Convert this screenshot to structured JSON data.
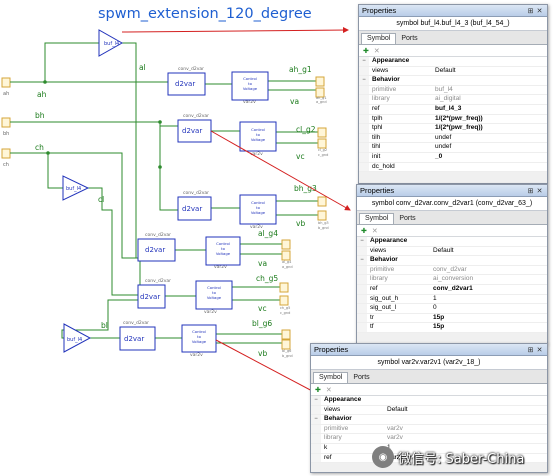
{
  "schematic": {
    "title": "spwm_extension_120_degree",
    "colors": {
      "title": "#1f5fd1",
      "wire": "#2e8b2e",
      "block": "#2233bb",
      "pin": "#d4a63a",
      "arrow": "#d42020",
      "label": "#1a7a1a",
      "caption": "#666666"
    },
    "input_ports": [
      {
        "name": "ah"
      },
      {
        "name": "bh"
      },
      {
        "name": "ch"
      }
    ],
    "net_labels": {
      "ah": "ah",
      "bh": "bh",
      "ch": "ch",
      "al": "al",
      "bl": "bl",
      "cl": "cl"
    },
    "buffers": [
      {
        "name": "buf_l4"
      },
      {
        "name": "buf_l4"
      },
      {
        "name": "buf_l4"
      }
    ],
    "converters": [
      {
        "caption": "conv_d2var",
        "label": "d2var"
      },
      {
        "caption": "conv_d2var",
        "label": "d2var"
      },
      {
        "caption": "conv_d2var",
        "label": "d2var"
      },
      {
        "caption": "conv_d2var",
        "label": "d2var"
      },
      {
        "caption": "conv_d2var",
        "label": "d2var"
      },
      {
        "caption": "conv_d2var",
        "label": "d2var"
      }
    ],
    "ctv_blocks": [
      {
        "caption": "var2v",
        "lines": [
          "Control",
          "to",
          "Voltage"
        ],
        "label": "ah_g1",
        "out": "va",
        "pins": [
          "ah_g1",
          "a_gnd"
        ]
      },
      {
        "caption": "var2v",
        "lines": [
          "Control",
          "to",
          "Voltage"
        ],
        "label": "cl_g2",
        "out": "vc",
        "pins": [
          "cl_g2",
          "c_gnd"
        ]
      },
      {
        "caption": "var2v",
        "lines": [
          "Control",
          "to",
          "Voltage"
        ],
        "label": "bh_g3",
        "out": "vb",
        "pins": [
          "bh_g3",
          "b_gnd"
        ]
      },
      {
        "caption": "var2v",
        "lines": [
          "Control",
          "to",
          "Voltage"
        ],
        "label": "al_g4",
        "out": "va",
        "pins": [
          "al_g4",
          "a_gnd"
        ]
      },
      {
        "caption": "var2v",
        "lines": [
          "Control",
          "to",
          "Voltage"
        ],
        "label": "ch_g5",
        "out": "vc",
        "pins": [
          "ch_g5",
          "c_gnd"
        ]
      },
      {
        "caption": "var2v",
        "lines": [
          "Control",
          "to",
          "Voltage"
        ],
        "label": "bl_g6",
        "out": "vb",
        "pins": [
          "bl_g6",
          "b_gnd"
        ]
      }
    ]
  },
  "panels": [
    {
      "title": "Properties",
      "symbol": "symbol buf_l4.buf_l4_3 (buf_l4_54_)",
      "tabs": [
        "Symbol",
        "Ports"
      ],
      "rows": [
        {
          "expander": "−",
          "name": "Appearance",
          "value": "",
          "style": "cat"
        },
        {
          "expander": "",
          "name": "views",
          "value": "Default",
          "style": "normal"
        },
        {
          "expander": "−",
          "name": "Behavior",
          "value": "",
          "style": "cat"
        },
        {
          "expander": "",
          "name": "primitive",
          "value": "buf_l4",
          "style": "dim"
        },
        {
          "expander": "",
          "name": "library",
          "value": "ai_digital",
          "style": "dim"
        },
        {
          "expander": "",
          "name": "ref",
          "value": "buf_l4_3",
          "style": "bold"
        },
        {
          "expander": "",
          "name": "tplh",
          "value": "1/(2*(pwr_freq))",
          "style": "bold"
        },
        {
          "expander": "",
          "name": "tphl",
          "value": "1/(2*(pwr_freq))",
          "style": "bold"
        },
        {
          "expander": "",
          "name": "tilh",
          "value": "undef",
          "style": "normal"
        },
        {
          "expander": "",
          "name": "tihl",
          "value": "undef",
          "style": "normal"
        },
        {
          "expander": "",
          "name": "init",
          "value": "_0",
          "style": "bold"
        },
        {
          "expander": "",
          "name": "dc_hold",
          "value": "",
          "style": "normal"
        }
      ]
    },
    {
      "title": "Properties",
      "symbol": "symbol conv_d2var.conv_d2var1 (conv_d2var_63_)",
      "tabs": [
        "Symbol",
        "Ports"
      ],
      "rows": [
        {
          "expander": "−",
          "name": "Appearance",
          "value": "",
          "style": "cat"
        },
        {
          "expander": "",
          "name": "views",
          "value": "Default",
          "style": "normal"
        },
        {
          "expander": "−",
          "name": "Behavior",
          "value": "",
          "style": "cat"
        },
        {
          "expander": "",
          "name": "primitive",
          "value": "conv_d2var",
          "style": "dim"
        },
        {
          "expander": "",
          "name": "library",
          "value": "ai_conversion",
          "style": "dim"
        },
        {
          "expander": "",
          "name": "ref",
          "value": "conv_d2var1",
          "style": "bold"
        },
        {
          "expander": "",
          "name": "sig_out_h",
          "value": "1",
          "style": "normal"
        },
        {
          "expander": "",
          "name": "sig_out_l",
          "value": "0",
          "style": "normal"
        },
        {
          "expander": "",
          "name": "tr",
          "value": "15p",
          "style": "bold"
        },
        {
          "expander": "",
          "name": "tf",
          "value": "15p",
          "style": "bold"
        }
      ]
    },
    {
      "title": "Properties",
      "symbol": "symbol var2v.var2v1 (var2v_18_)",
      "tabs": [
        "Symbol",
        "Ports"
      ],
      "rows": [
        {
          "expander": "−",
          "name": "Appearance",
          "value": "",
          "style": "cat"
        },
        {
          "expander": "",
          "name": "views",
          "value": "Default",
          "style": "normal"
        },
        {
          "expander": "−",
          "name": "Behavior",
          "value": "",
          "style": "cat"
        },
        {
          "expander": "",
          "name": "primitive",
          "value": "var2v",
          "style": "dim"
        },
        {
          "expander": "",
          "name": "library",
          "value": "var2v",
          "style": "dim"
        },
        {
          "expander": "",
          "name": "k",
          "value": "1",
          "style": "normal"
        },
        {
          "expander": "",
          "name": "ref",
          "value": "var2v1",
          "style": "bold"
        }
      ]
    }
  ],
  "panel_icons": {
    "pin": "pin-icon",
    "close": "close-icon",
    "add": "add-icon",
    "delete": "delete-icon"
  },
  "watermark": {
    "text": "微信号: Saber-China"
  }
}
